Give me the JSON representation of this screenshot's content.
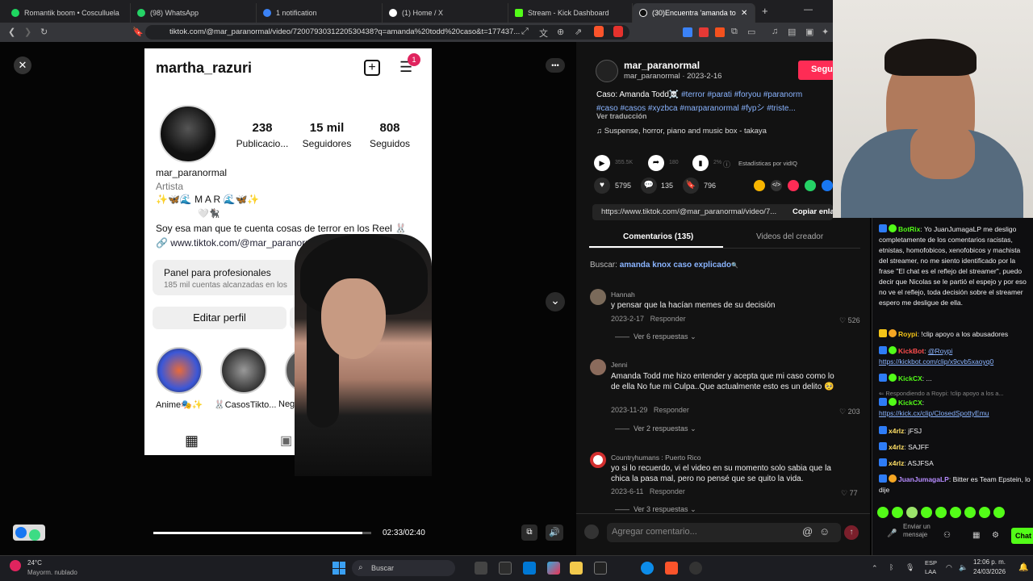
{
  "browser": {
    "tabs": [
      {
        "label": "Romantik boom • Cosculluela",
        "color": "#1ed760"
      },
      {
        "label": "(98) WhatsApp",
        "color": "#25d366"
      },
      {
        "label": "1 notification",
        "color": "#3b82f6"
      },
      {
        "label": "(1) Home / X",
        "color": "#ffffff"
      },
      {
        "label": "Stream - Kick Dashboard",
        "color": "#53fc18"
      },
      {
        "label": "(30)Encuentra 'amanda todd",
        "color": "#111111"
      }
    ],
    "new_tab": "+",
    "url": "tiktok.com/@mar_paranormal/video/7200793031220530438?q=amanda%20todd%20caso&t=177437..."
  },
  "video": {
    "close": "✕",
    "more": "•••",
    "time": "02:33/02:40",
    "progress": 0.96,
    "chevron": "⌄"
  },
  "phone": {
    "username": "martha_razuri",
    "notif_count": "1",
    "stats": [
      {
        "value": "238",
        "label": "Publicacio..."
      },
      {
        "value": "15 mil",
        "label": "Seguidores"
      },
      {
        "value": "808",
        "label": "Seguidos"
      }
    ],
    "name": "mar_paranormal",
    "category": "Artista",
    "bio_line1": "✨🦋🌊 M A R 🌊🦋✨",
    "bio_line2": "🤍🐈‍⬛",
    "bio_line3": "Soy esa man que te cuenta cosas de terror en los Reel 🐰",
    "link": "www.tiktok.com/@mar_paranormal?_t=8eDoty67P...",
    "panel_title": "Panel para profesionales",
    "panel_sub": "185 mil cuentas alcanzadas en los",
    "edit_profile": "Editar perfil",
    "highlights": [
      "Anime🎭✨",
      "🐰CasosTikto...",
      "Negr..."
    ]
  },
  "post": {
    "author": "mar_paranormal",
    "sub": "mar_paranormal · 2023-2-16",
    "follow": "Seguir",
    "caption_plain": "Caso: Amanda Todd☠️",
    "caption_tags1": "#terror #parati #foryou #paranorm",
    "caption_tags2": "#caso #casos #xyzbca #marparanormal #fypシ #triste...",
    "translate": "Ver traducción",
    "music": "Suspense, horror, piano and music box - takaya",
    "plays": "355.5K",
    "shares": "180",
    "pct": "2%",
    "stats_label": "Estadísticas por vidIQ",
    "likes": "5795",
    "comments": "135",
    "saves": "796",
    "share_url": "https://www.tiktok.com/@mar_paranormal/video/7...",
    "copy_link": "Copiar enla",
    "tab_comments": "Comentarios (135)",
    "tab_creator": "Videos del creador",
    "search_label": "Buscar:",
    "search_term": "amanda knox caso explicado",
    "comment_placeholder": "Agregar comentario...",
    "comments_list": [
      {
        "name": "Hannah",
        "text": "y pensar que la hacían memes de su decisión",
        "date": "2023-2-17",
        "reply": "Responder",
        "likes": "526",
        "more": "Ver 6 respuestas"
      },
      {
        "name": "Jenni",
        "text": "Amanda Todd me hizo entender y acepta que mi caso como lo de ella No fue mi Culpa..Que actualmente esto es un delito 🥺",
        "date": "2023-11-29",
        "reply": "Responder",
        "likes": "203",
        "more": "Ver 2 respuestas"
      },
      {
        "name": "Countryhumans : Puerto Rico",
        "text": "yo si lo recuerdo, vi el video en su momento solo sabia que la chica la pasa mal, pero no pensé que se quito la vida.",
        "date": "2023-6-11",
        "reply": "Responder",
        "likes": "77",
        "more": "Ver 3 respuestas"
      }
    ]
  },
  "chat": {
    "messages": [
      {
        "user": "BotRix",
        "color": "#53fc18",
        "text": "Yo JuanJumagaLP me desligo completamente de los comentarios racistas, etnistas, homofobicos, xenofobicos y machista del streamer, no me siento identificado por la frase \"El chat es el reflejo del streamer\", puedo decir que Nicolas se le partió el espejo y por eso no ve el reflejo, toda decisión sobre el streamer espero me desligue de ella."
      },
      {
        "user": "Roypi",
        "color": "#f5c518",
        "text": "!clip apoyo a los abusadores"
      },
      {
        "user": "KickBot",
        "color": "#ff4d4d",
        "text": "@Roypi https://kickbot.com/clip/x9cvb5xaoyq0"
      },
      {
        "user": "KickCX",
        "color": "#53fc18",
        "text": "..."
      },
      {
        "user": "Respondiendo a Roypi",
        "color": "#888888",
        "text": "!clip apoyo a los a..."
      },
      {
        "user": "KickCX",
        "color": "#53fc18",
        "text": "https://kick.cx/clip/ClosedSpottyEmu"
      },
      {
        "user": "x4rlz",
        "color": "#ffe066",
        "text": "jFSJ"
      },
      {
        "user": "x4rlz",
        "color": "#ffe066",
        "text": "SAJFF"
      },
      {
        "user": "x4rlz",
        "color": "#ffe066",
        "text": "ASJFSA"
      },
      {
        "user": "JuanJumagaLP",
        "color": "#b68cff",
        "text": "Bitter es Team Epstein, lo dije"
      }
    ],
    "send_label": "Enviar un mensaje",
    "chat_button": "Chat"
  },
  "taskbar": {
    "weather_temp": "24°C",
    "weather_desc": "Mayorm. nublado",
    "search": "Buscar",
    "lang": "ESP",
    "lang2": "LAA",
    "time": "12:06 p. m.",
    "date": "24/03/2026"
  }
}
